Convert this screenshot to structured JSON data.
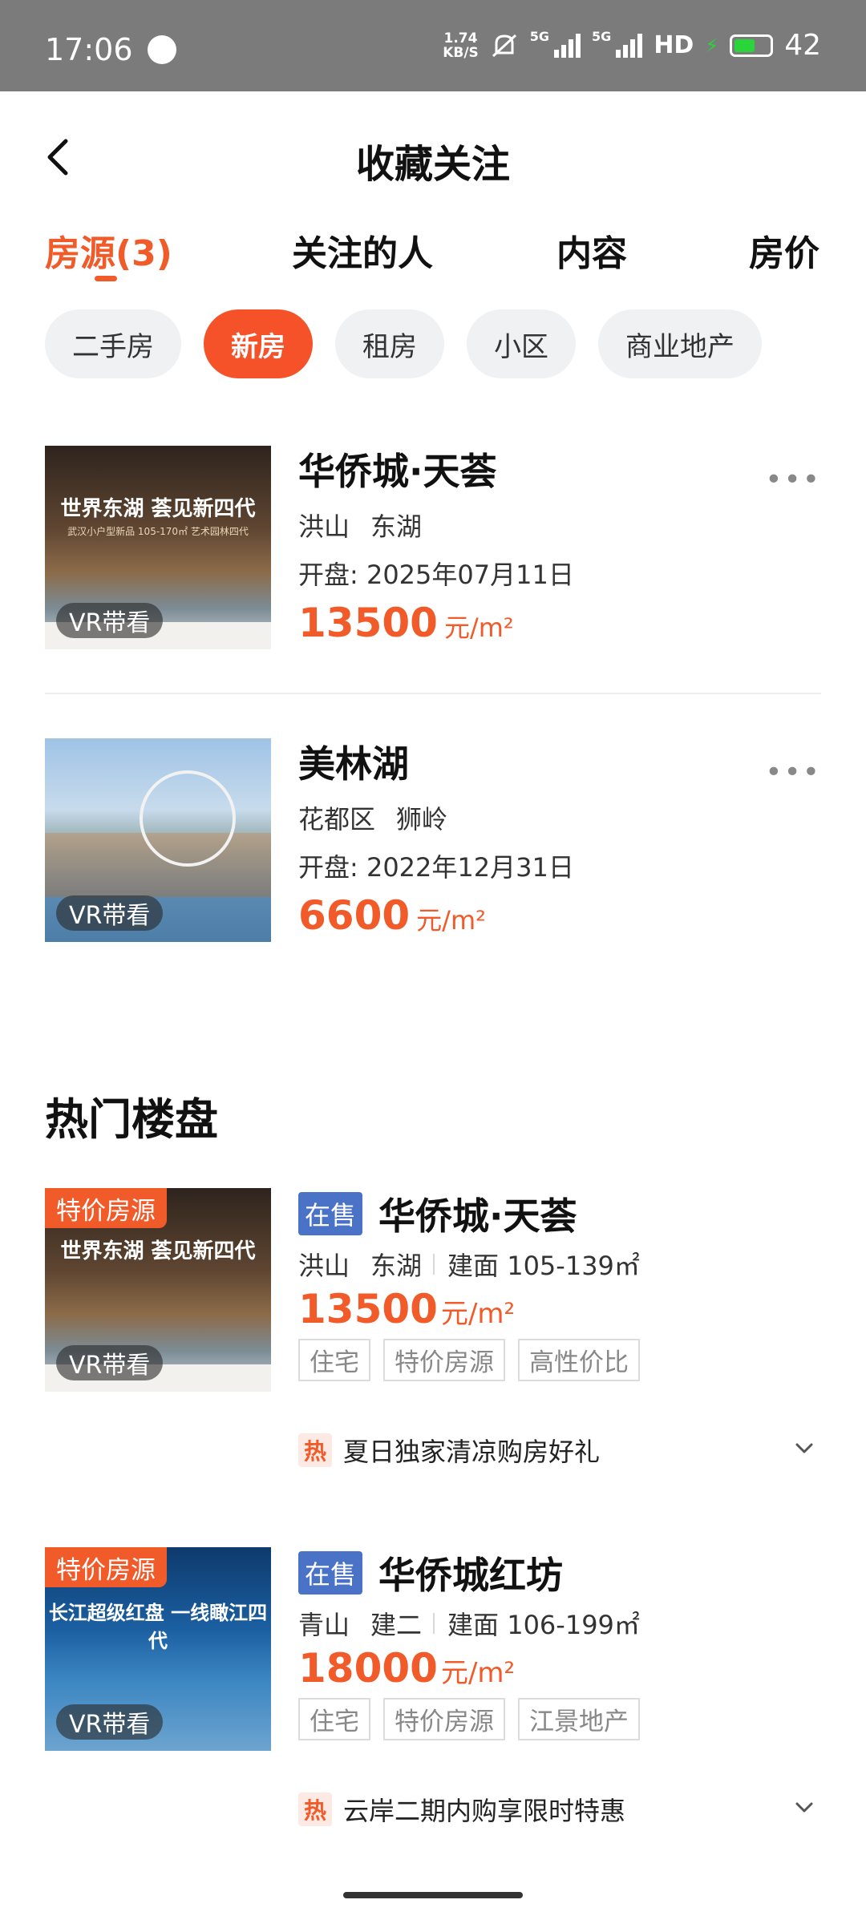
{
  "status_bar": {
    "time": "17:06",
    "net_speed_value": "1.74",
    "net_speed_unit": "KB/S",
    "signal1_label": "5G",
    "signal2_label": "5G",
    "hd_label": "HD",
    "battery_level": "42",
    "battery_color": "#2ad53a"
  },
  "header": {
    "title": "收藏关注"
  },
  "tabs": [
    {
      "label": "房源(3)",
      "active": true
    },
    {
      "label": "关注的人",
      "active": false
    },
    {
      "label": "内容",
      "active": false
    },
    {
      "label": "房价",
      "active": false
    }
  ],
  "filters": [
    {
      "label": "二手房",
      "active": false
    },
    {
      "label": "新房",
      "active": true
    },
    {
      "label": "租房",
      "active": false
    },
    {
      "label": "小区",
      "active": false
    },
    {
      "label": "商业地产",
      "active": false
    }
  ],
  "favorites": [
    {
      "name": "华侨城·天荟",
      "district": "洪山",
      "area": "东湖",
      "open_date": "开盘: 2025年07月11日",
      "price": "13500",
      "unit": "元/m²",
      "vr_label": "VR带看",
      "thumb_text1": "世界东湖 荟见新四代",
      "thumb_text2": "武汉小户型新品 105-170㎡ 艺术园林四代"
    },
    {
      "name": "美林湖",
      "district": "花都区",
      "area": "狮岭",
      "open_date": "开盘: 2022年12月31日",
      "price": "6600",
      "unit": "元/m²",
      "vr_label": "VR带看"
    }
  ],
  "hot_section": {
    "title": "热门楼盘",
    "items": [
      {
        "badge": "特价房源",
        "status": "在售",
        "name": "华侨城·天荟",
        "district": "洪山",
        "area": "东湖",
        "size": "建面 105-139㎡",
        "price": "13500",
        "unit": "元/m²",
        "tags": [
          "住宅",
          "特价房源",
          "高性价比"
        ],
        "promo_icon": "热",
        "promo": "夏日独家清凉购房好礼",
        "vr_label": "VR带看",
        "thumb_text1": "世界东湖 荟见新四代"
      },
      {
        "badge": "特价房源",
        "status": "在售",
        "name": "华侨城红坊",
        "district": "青山",
        "area": "建二",
        "size": "建面 106-199㎡",
        "price": "18000",
        "unit": "元/m²",
        "tags": [
          "住宅",
          "特价房源",
          "江景地产"
        ],
        "promo_icon": "热",
        "promo": "云岸二期内购享限时特惠",
        "vr_label": "VR带看",
        "thumb_text1": "长江超级红盘 一线瞰江四代"
      }
    ]
  },
  "colors": {
    "accent": "#f15a29",
    "status_tag": "#4a73c7"
  }
}
